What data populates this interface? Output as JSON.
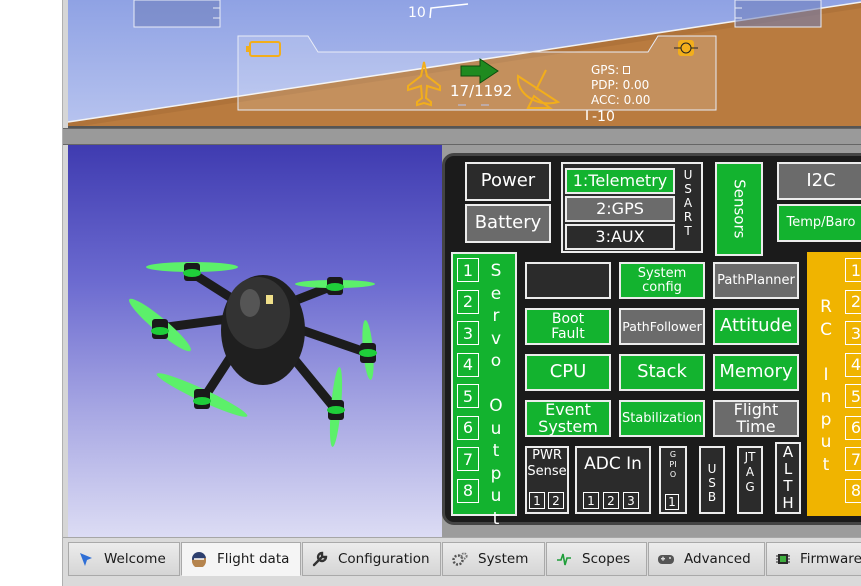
{
  "pfd": {
    "pitch_top": "10",
    "pitch_bottom": "-10",
    "waypoint": "17/1192",
    "gps": "GPS:",
    "pdp": "PDP: 0.00",
    "acc": "ACC: 0.00"
  },
  "board": {
    "power": "Power",
    "battery": "Battery",
    "telemetry": "1:Telemetry",
    "gps": "2:GPS",
    "aux": "3:AUX",
    "usart": "USART",
    "sensors": "Sensors",
    "i2c": "I2C",
    "temp_baro": "Temp/Baro",
    "servo_output": "Servo Output",
    "servo_ports": [
      "1",
      "2",
      "3",
      "4",
      "5",
      "6",
      "7",
      "8"
    ],
    "system_config": "System config",
    "path_planner": "PathPlanner",
    "boot_fault": "Boot Fault",
    "path_follower": "PathFollower",
    "attitude": "Attitude",
    "cpu": "CPU",
    "stack": "Stack",
    "memory": "Memory",
    "event_system": "Event System",
    "stabilization": "Stabilization",
    "flight_time": "Flight Time",
    "rc_input": "RC Input",
    "rc_ports": [
      "1",
      "2",
      "3",
      "4",
      "5",
      "6",
      "7",
      "8"
    ],
    "pwr_sense": "PWR Sense",
    "pwr_ports": [
      "1",
      "2"
    ],
    "adc_in": "ADC In",
    "adc_ports": [
      "1",
      "2",
      "3"
    ],
    "gpio": "GPIO",
    "gpio_port": "1",
    "usb": "USB",
    "jtag": "JTAG",
    "alth": "ALTH"
  },
  "tabs": [
    {
      "label": "Welcome",
      "icon": "welcome-icon"
    },
    {
      "label": "Flight data",
      "icon": "flight-data-icon"
    },
    {
      "label": "Configuration",
      "icon": "wrench-icon"
    },
    {
      "label": "System",
      "icon": "gears-icon"
    },
    {
      "label": "Scopes",
      "icon": "scope-icon"
    },
    {
      "label": "Advanced",
      "icon": "gamepad-icon"
    },
    {
      "label": "Firmware",
      "icon": "chip-icon"
    }
  ],
  "colors": {
    "ok_green": "#13b32f",
    "rc_yellow": "#f0b400",
    "sky": "#a9b7ea",
    "ground": "#b97b3f",
    "pfd_orange": "#f2ae1c"
  }
}
